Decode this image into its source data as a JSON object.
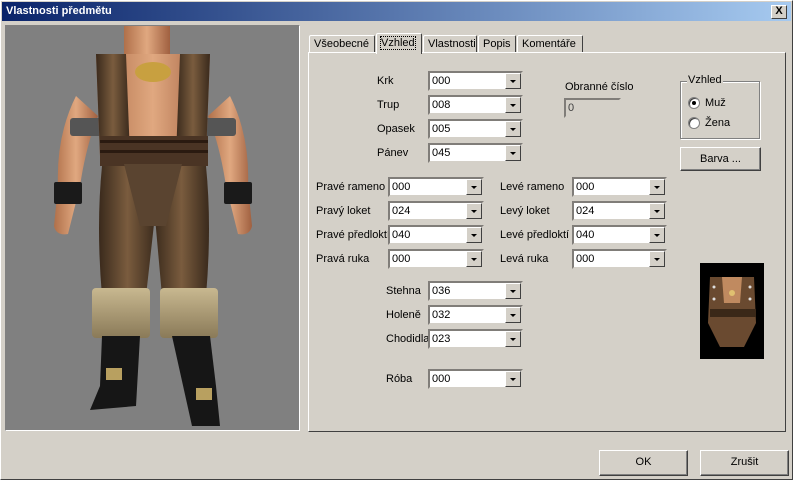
{
  "window": {
    "title": "Vlastnosti předmětu",
    "close_label": "X"
  },
  "tabs": [
    {
      "label": "Všeobecné",
      "active": false
    },
    {
      "label": "Vzhled",
      "active": true
    },
    {
      "label": "Vlastnosti",
      "active": false
    },
    {
      "label": "Popis",
      "active": false
    },
    {
      "label": "Komentáře",
      "active": false
    }
  ],
  "body_parts": {
    "krk": {
      "label": "Krk",
      "value": "000"
    },
    "trup": {
      "label": "Trup",
      "value": "008"
    },
    "opasek": {
      "label": "Opasek",
      "value": "005"
    },
    "panev": {
      "label": "Pánev",
      "value": "045"
    },
    "prave_rameno": {
      "label": "Pravé rameno",
      "value": "000"
    },
    "prave_loket": {
      "label": "Pravý loket",
      "value": "024"
    },
    "prave_predlokti": {
      "label": "Pravé předloktí",
      "value": "040"
    },
    "prava_ruka": {
      "label": "Pravá ruka",
      "value": "000"
    },
    "leve_rameno": {
      "label": "Levé rameno",
      "value": "000"
    },
    "levy_loket": {
      "label": "Levý loket",
      "value": "024"
    },
    "leve_predlokti": {
      "label": "Levé předloktí",
      "value": "040"
    },
    "leva_ruka": {
      "label": "Levá ruka",
      "value": "000"
    },
    "stehna": {
      "label": "Stehna",
      "value": "036"
    },
    "holene": {
      "label": "Holeně",
      "value": "032"
    },
    "chodidla": {
      "label": "Chodidla",
      "value": "023"
    },
    "roba": {
      "label": "Róba",
      "value": "000"
    }
  },
  "armor_class": {
    "label": "Obranné číslo",
    "value": "0"
  },
  "appearance_group": {
    "title": "Vzhled",
    "options": [
      {
        "label": "Muž",
        "checked": true
      },
      {
        "label": "Žena",
        "checked": false
      }
    ]
  },
  "color_button": "Barva ...",
  "footer": {
    "ok": "OK",
    "cancel": "Zrušit"
  },
  "colors": {
    "title_start": "#0a246a",
    "title_end": "#a6caf0",
    "face": "#d4d0c8"
  }
}
